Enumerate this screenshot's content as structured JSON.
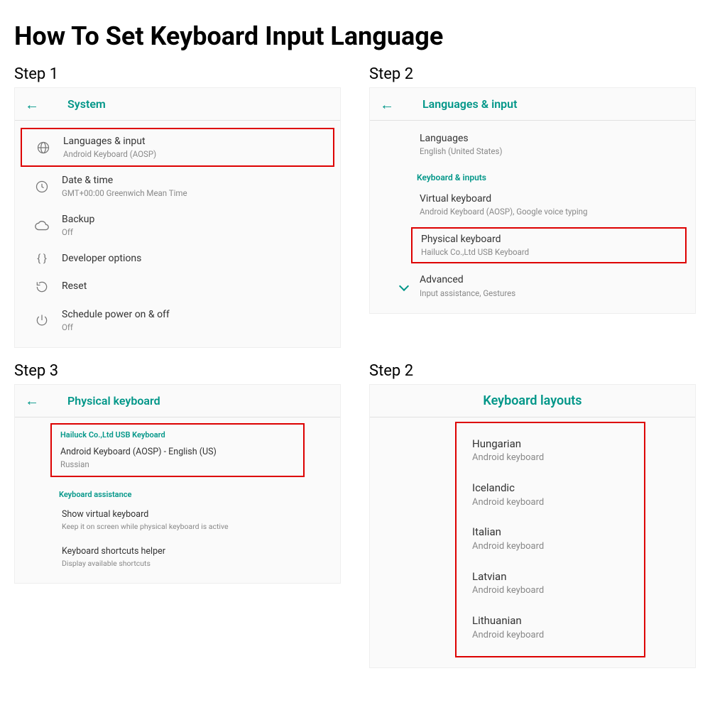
{
  "title": "How To Set Keyboard Input Language",
  "steps": {
    "s1": {
      "label": "Step 1",
      "header": "System",
      "items": [
        {
          "title": "Languages & input",
          "sub": "Android Keyboard (AOSP)"
        },
        {
          "title": "Date & time",
          "sub": "GMT+00:00 Greenwich Mean Time"
        },
        {
          "title": "Backup",
          "sub": "Off"
        },
        {
          "title": "Developer options",
          "sub": ""
        },
        {
          "title": "Reset",
          "sub": ""
        },
        {
          "title": "Schedule power on & off",
          "sub": "Off"
        }
      ]
    },
    "s2": {
      "label": "Step 2",
      "header": "Languages & input",
      "items": [
        {
          "title": "Languages",
          "sub": "English (United States)"
        }
      ],
      "section": "Keyboard & inputs",
      "sectionItems": [
        {
          "title": "Virtual keyboard",
          "sub": "Android Keyboard (AOSP), Google voice typing"
        },
        {
          "title": "Physical keyboard",
          "sub": "Hailuck Co.,Ltd USB Keyboard"
        },
        {
          "title": "Advanced",
          "sub": "Input assistance, Gestures"
        }
      ]
    },
    "s3": {
      "label": "Step 3",
      "header": "Physical keyboard",
      "section1": "Hailuck Co.,Ltd USB Keyboard",
      "item1": {
        "title": "Android Keyboard (AOSP) - English (US)",
        "sub": "Russian"
      },
      "section2": "Keyboard assistance",
      "items2": [
        {
          "title": "Show virtual keyboard",
          "sub": "Keep it on screen while physical keyboard is active"
        },
        {
          "title": "Keyboard shortcuts helper",
          "sub": "Display available shortcuts"
        }
      ]
    },
    "s4": {
      "label": "Step 2",
      "header": "Keyboard layouts",
      "items": [
        {
          "title": "Hungarian",
          "sub": "Android keyboard"
        },
        {
          "title": "Icelandic",
          "sub": "Android keyboard"
        },
        {
          "title": "Italian",
          "sub": "Android keyboard"
        },
        {
          "title": "Latvian",
          "sub": "Android keyboard"
        },
        {
          "title": "Lithuanian",
          "sub": "Android keyboard"
        }
      ]
    }
  }
}
